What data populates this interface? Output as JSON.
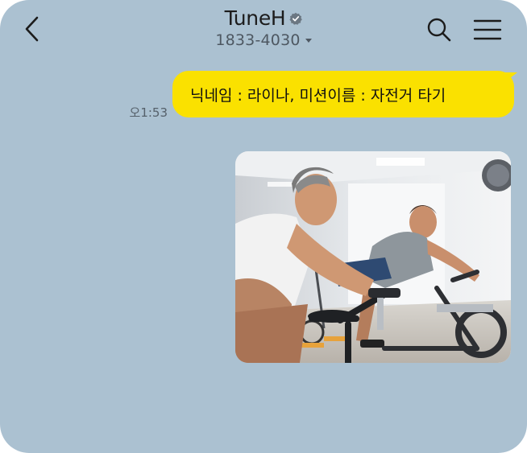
{
  "header": {
    "back_icon": "chevron-left-icon",
    "title": "TuneH",
    "verified_icon": "verified-badge-icon",
    "subtitle": "1833-4030",
    "subtitle_dropdown_icon": "caret-down-icon",
    "search_icon": "search-icon",
    "menu_icon": "hamburger-menu-icon"
  },
  "messages": [
    {
      "type": "text",
      "sender": "me",
      "text": "닉네임 : 라이나, 미션이름 :  자전거 타기",
      "time": "오1:53",
      "bubble_color": "#fae100"
    },
    {
      "type": "image",
      "sender": "me",
      "image_description_icon": "photo-spin-bike-class"
    }
  ],
  "colors": {
    "background": "#abc1d1",
    "bubble_me": "#fae100",
    "text_dark": "#1c1c1c",
    "text_muted": "#4e5862"
  }
}
